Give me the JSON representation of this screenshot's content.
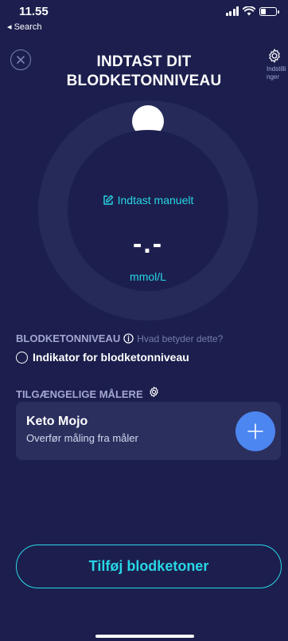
{
  "status_bar": {
    "time": "11.55",
    "back_label": "◂ Search"
  },
  "header": {
    "title_line1": "INDTAST DIT",
    "title_line2": "BLODKETONNIVEAU",
    "settings_label": "Indstillinger"
  },
  "gauge": {
    "manual_entry_label": "Indtast manuelt",
    "reading": "-.-",
    "unit": "mmol/L"
  },
  "ketone_section": {
    "label": "BLODKETONNIVEAU",
    "help_link": "Hvad betyder dette?",
    "indicator_label": "Indikator for blodketonniveau"
  },
  "meters_section": {
    "label": "TILGÆNGELIGE MÅLERE",
    "meters": [
      {
        "name": "Keto Mojo",
        "description": "Overfør måling fra måler"
      }
    ]
  },
  "submit_button": {
    "label": "Tilføj blodketoner"
  },
  "colors": {
    "background": "#1c1f4d",
    "accent_cyan": "#28d6e6",
    "add_button_blue": "#4c86f0",
    "card": "#2b2f5e",
    "muted_label": "#a3a7cf"
  }
}
